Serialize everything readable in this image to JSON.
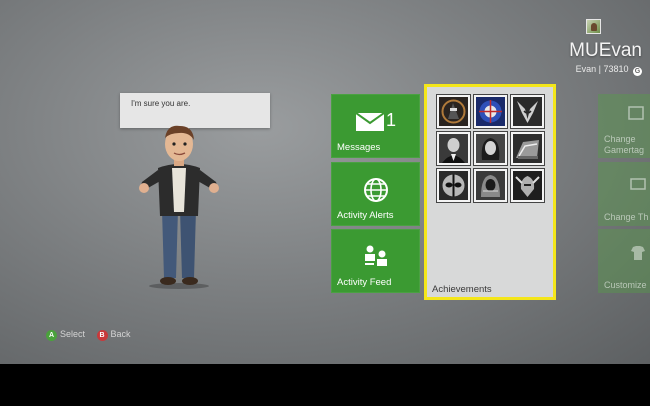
{
  "profile": {
    "gamertag": "MUEvan",
    "name": "Evan",
    "separator": "|",
    "gamerscore": "73810",
    "gamerscore_icon": "G"
  },
  "bubble": {
    "text": "I'm sure you are."
  },
  "tiles": {
    "messages": {
      "label": "Messages",
      "count": "1"
    },
    "activity_alerts": {
      "label": "Activity Alerts"
    },
    "activity_feed": {
      "label": "Activity Feed"
    },
    "achievements": {
      "label": "Achievements"
    }
  },
  "achievement_icons": [
    "ninja-achievement",
    "shield-face-achievement",
    "wolverine-achievement",
    "suited-man-achievement",
    "woman-face-achievement",
    "tank-achievement",
    "deadpool-achievement",
    "hooded-figure-achievement",
    "winged-helmet-achievement"
  ],
  "side_tiles": {
    "change_gamertag": [
      "Change",
      "Gamertag"
    ],
    "change_theme": "Change Th",
    "customize": "Customize"
  },
  "hints": {
    "a_glyph": "A",
    "a_label": "Select",
    "b_glyph": "B",
    "b_label": "Back"
  },
  "colors": {
    "tile_green": "#3b9a32",
    "highlight": "#f4e61a"
  }
}
